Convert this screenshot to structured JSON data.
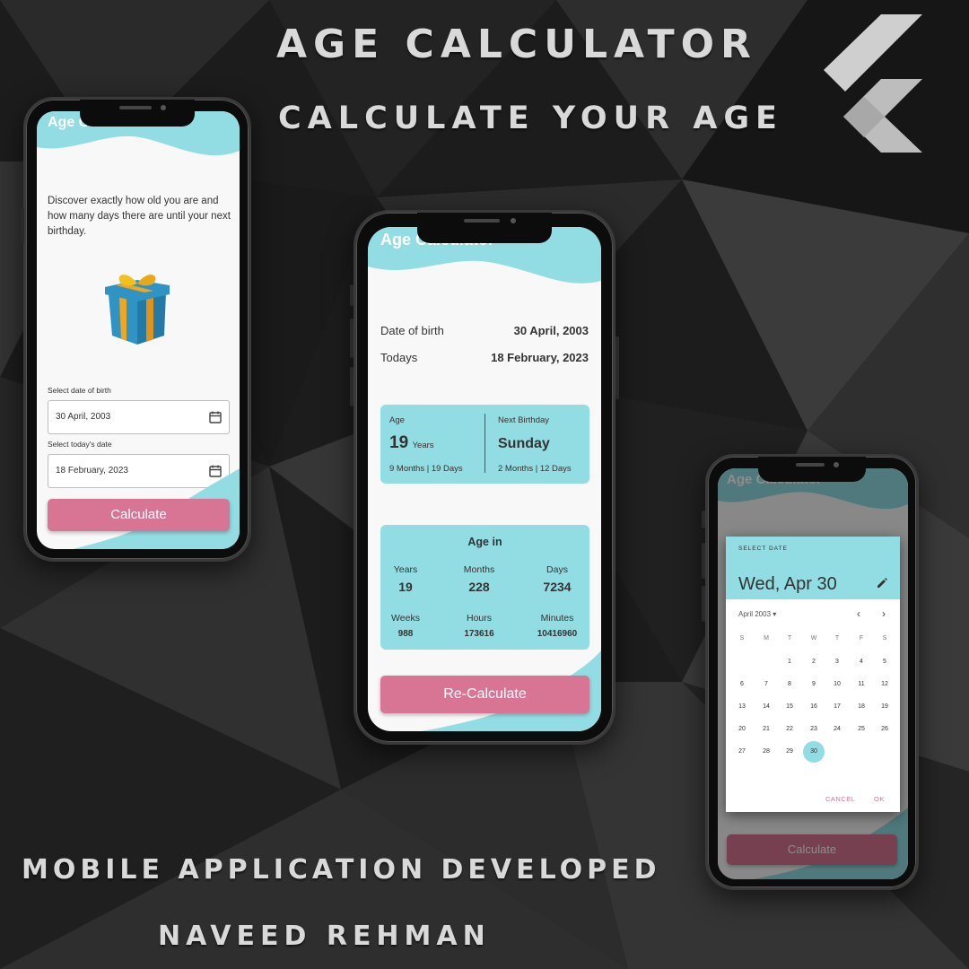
{
  "poster": {
    "title": "AGE CALCULATOR",
    "subtitle": "CALCULATE YOUR AGE",
    "footer_line1": "MOBILE APPLICATION DEVELOPED",
    "footer_line2": "NAVEED REHMAN",
    "logo_icon": "flutter-logo-icon"
  },
  "colors": {
    "accent_teal": "#92dde3",
    "accent_pink": "#d97594",
    "background": "#1a1a1a"
  },
  "screen1": {
    "app_title": "Age Calculator",
    "description": "Discover exactly how old you are and how many days there are until your next birthday.",
    "image_icon": "gift-box-icon",
    "dob_label": "Select date of birth",
    "dob_value": "30 April, 2003",
    "today_label": "Select today's date",
    "today_value": "18 February, 2023",
    "button": "Calculate"
  },
  "screen2": {
    "app_title": "Age Calculator",
    "dob_label": "Date of birth",
    "dob_value": "30 April, 2003",
    "today_label": "Todays",
    "today_value": "18 February, 2023",
    "age_card": {
      "age_label": "Age",
      "years_value": "19",
      "years_unit": "Years",
      "age_detail": "9 Months | 19 Days",
      "next_birthday_label": "Next Birthday",
      "next_birthday_day": "Sunday",
      "next_birthday_detail": "2 Months | 12 Days"
    },
    "age_in": {
      "title": "Age in",
      "years_label": "Years",
      "years": "19",
      "months_label": "Months",
      "months": "228",
      "days_label": "Days",
      "days": "7234",
      "weeks_label": "Weeks",
      "weeks": "988",
      "hours_label": "Hours",
      "hours": "173616",
      "minutes_label": "Minutes",
      "minutes": "10416960"
    },
    "button": "Re-Calculate"
  },
  "screen3": {
    "app_title": "Age Calculator",
    "dialog": {
      "header_label": "SELECT DATE",
      "selected_date": "Wed, Apr 30",
      "month": "April 2003",
      "weekdays": [
        "S",
        "M",
        "T",
        "W",
        "T",
        "F",
        "S"
      ],
      "days": [
        "1",
        "2",
        "3",
        "4",
        "5",
        "6",
        "7",
        "8",
        "9",
        "10",
        "11",
        "12",
        "13",
        "14",
        "15",
        "16",
        "17",
        "18",
        "19",
        "20",
        "21",
        "22",
        "23",
        "24",
        "25",
        "26",
        "27",
        "28",
        "29",
        "30"
      ],
      "first_weekday_index": 2,
      "selected_day": "30",
      "cancel": "CANCEL",
      "ok": "OK"
    },
    "button": "Calculate"
  }
}
